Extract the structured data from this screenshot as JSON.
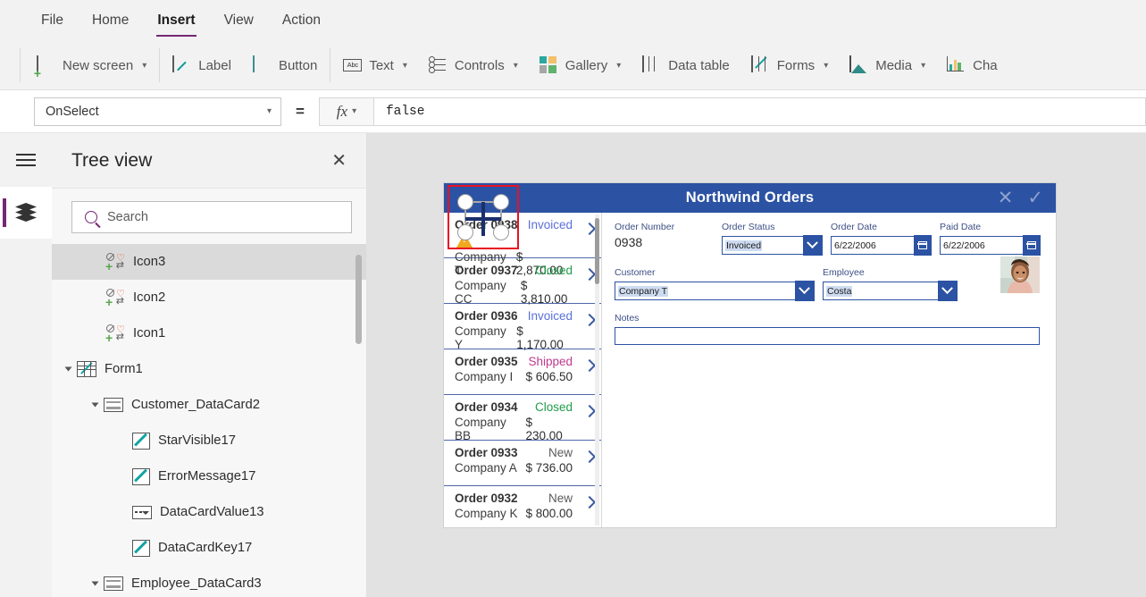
{
  "menu": {
    "items": [
      {
        "label": "File",
        "active": false
      },
      {
        "label": "Home",
        "active": false
      },
      {
        "label": "Insert",
        "active": true
      },
      {
        "label": "View",
        "active": false
      },
      {
        "label": "Action",
        "active": false
      }
    ]
  },
  "ribbon": {
    "new_screen": "New screen",
    "label": "Label",
    "button": "Button",
    "text": "Text",
    "text_icon_label": "Abc",
    "controls": "Controls",
    "gallery": "Gallery",
    "data_table": "Data table",
    "forms": "Forms",
    "media": "Media",
    "charts": "Cha",
    "gallery_colors": [
      "#2aa8a0",
      "#f3c06b",
      "#a6a6a6",
      "#5fb36a"
    ]
  },
  "formula_bar": {
    "property": "OnSelect",
    "equals": "=",
    "fx_label": "fx",
    "formula": "false"
  },
  "tree_panel": {
    "title": "Tree view",
    "close_label": "✕",
    "search_placeholder": "Search",
    "items": [
      {
        "label": "Icon3",
        "icon": "quad-icon",
        "indent": 2,
        "selected": true,
        "expander": false
      },
      {
        "label": "Icon2",
        "icon": "quad-icon",
        "indent": 2,
        "selected": false,
        "expander": false
      },
      {
        "label": "Icon1",
        "icon": "quad-icon",
        "indent": 2,
        "selected": false,
        "expander": false
      },
      {
        "label": "Form1",
        "icon": "form-icon",
        "indent": 1,
        "selected": false,
        "expander": true
      },
      {
        "label": "Customer_DataCard2",
        "icon": "datacard-icon",
        "indent": 2,
        "selected": false,
        "expander": true
      },
      {
        "label": "StarVisible17",
        "icon": "pen-icon",
        "indent": 3,
        "selected": false,
        "expander": false
      },
      {
        "label": "ErrorMessage17",
        "icon": "pen-icon",
        "indent": 3,
        "selected": false,
        "expander": false
      },
      {
        "label": "DataCardValue13",
        "icon": "dropdown-icon",
        "indent": 3,
        "selected": false,
        "expander": false
      },
      {
        "label": "DataCardKey17",
        "icon": "pen-icon",
        "indent": 3,
        "selected": false,
        "expander": false
      },
      {
        "label": "Employee_DataCard3",
        "icon": "datacard-icon",
        "indent": 2,
        "selected": false,
        "expander": true
      }
    ]
  },
  "app_preview": {
    "title": "Northwind Orders",
    "header_cancel_icon": "✕",
    "header_confirm_icon": "✓",
    "status_colors": {
      "Invoiced": "#5a6fd8",
      "Closed": "#1f9c4a",
      "Shipped": "#c0398f",
      "New": "#5a5a5a"
    },
    "gallery": [
      {
        "order": "Order 0938",
        "company": "Company T",
        "status": "Invoiced",
        "amount": "$ 2,870.00",
        "warning": true
      },
      {
        "order": "Order 0937",
        "company": "Company CC",
        "status": "Closed",
        "amount": "$ 3,810.00",
        "warning": false
      },
      {
        "order": "Order 0936",
        "company": "Company Y",
        "status": "Invoiced",
        "amount": "$ 1,170.00",
        "warning": false
      },
      {
        "order": "Order 0935",
        "company": "Company I",
        "status": "Shipped",
        "amount": "$ 606.50",
        "warning": false
      },
      {
        "order": "Order 0934",
        "company": "Company BB",
        "status": "Closed",
        "amount": "$ 230.00",
        "warning": false
      },
      {
        "order": "Order 0933",
        "company": "Company A",
        "status": "New",
        "amount": "$ 736.00",
        "warning": false
      },
      {
        "order": "Order 0932",
        "company": "Company K",
        "status": "New",
        "amount": "$ 800.00",
        "warning": false
      }
    ],
    "form": {
      "order_number_label": "Order Number",
      "order_number_value": "0938",
      "order_status_label": "Order Status",
      "order_status_value": "Invoiced",
      "order_date_label": "Order Date",
      "order_date_value": "6/22/2006",
      "paid_date_label": "Paid Date",
      "paid_date_value": "6/22/2006",
      "customer_label": "Customer",
      "customer_value": "Company T",
      "employee_label": "Employee",
      "employee_value": "Costa",
      "notes_label": "Notes",
      "notes_value": ""
    }
  }
}
